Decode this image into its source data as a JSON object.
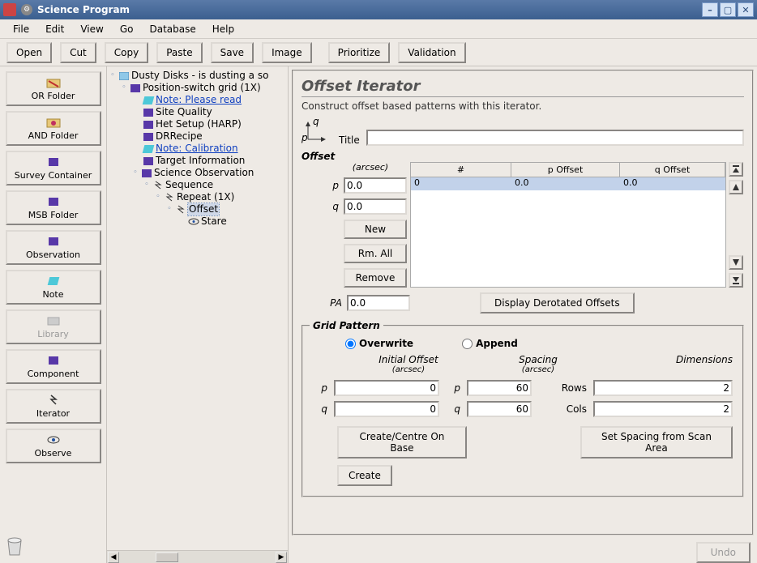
{
  "window": {
    "title": "Science Program"
  },
  "menu": {
    "file": "File",
    "edit": "Edit",
    "view": "View",
    "go": "Go",
    "database": "Database",
    "help": "Help"
  },
  "toolbar": {
    "open": "Open",
    "cut": "Cut",
    "copy": "Copy",
    "paste": "Paste",
    "save": "Save",
    "image": "Image",
    "prioritize": "Prioritize",
    "validation": "Validation"
  },
  "sidebar": {
    "or_folder": "OR Folder",
    "and_folder": "AND Folder",
    "survey_container": "Survey Container",
    "msb_folder": "MSB Folder",
    "observation": "Observation",
    "note": "Note",
    "library": "Library",
    "component": "Component",
    "iterator": "Iterator",
    "observe": "Observe"
  },
  "tree": {
    "root": "Dusty Disks - is dusting a so",
    "grid": "Position-switch grid (1X)",
    "note_read": "Note: Please read",
    "site_quality": "Site Quality",
    "het_setup": "Het Setup (HARP)",
    "drrecipe": "DRRecipe",
    "note_calib": "Note: Calibration",
    "target_info": "Target Information",
    "sci_obs": "Science Observation",
    "sequence": "Sequence",
    "repeat": "Repeat (1X)",
    "offset": "Offset",
    "stare": "Stare"
  },
  "panel": {
    "title": "Offset Iterator",
    "subtitle": "Construct offset based patterns with this iterator.",
    "title_label": "Title",
    "title_value": "",
    "offset_legend": "Offset",
    "arcsec": "(arcsec)",
    "p_label": "p",
    "q_label": "q",
    "p_value": "0.0",
    "q_value": "0.0",
    "new_btn": "New",
    "rmall_btn": "Rm. All",
    "remove_btn": "Remove",
    "pa_label": "PA",
    "pa_value": "0.0",
    "derot_btn": "Display Derotated Offsets",
    "table": {
      "col_idx": "#",
      "col_p": "p Offset",
      "col_q": "q Offset",
      "rows": [
        {
          "idx": "0",
          "p": "0.0",
          "q": "0.0"
        }
      ]
    },
    "grid": {
      "legend": "Grid Pattern",
      "overwrite": "Overwrite",
      "append": "Append",
      "initial_offset": "Initial Offset",
      "spacing": "Spacing",
      "dimensions": "Dimensions",
      "p_off": "0",
      "q_off": "0",
      "p_sp": "60",
      "q_sp": "60",
      "rows_label": "Rows",
      "cols_label": "Cols",
      "rows_val": "2",
      "cols_val": "2",
      "create_centre": "Create/Centre On Base",
      "set_spacing": "Set Spacing from Scan Area",
      "create": "Create"
    }
  },
  "footer": {
    "undo": "Undo"
  }
}
